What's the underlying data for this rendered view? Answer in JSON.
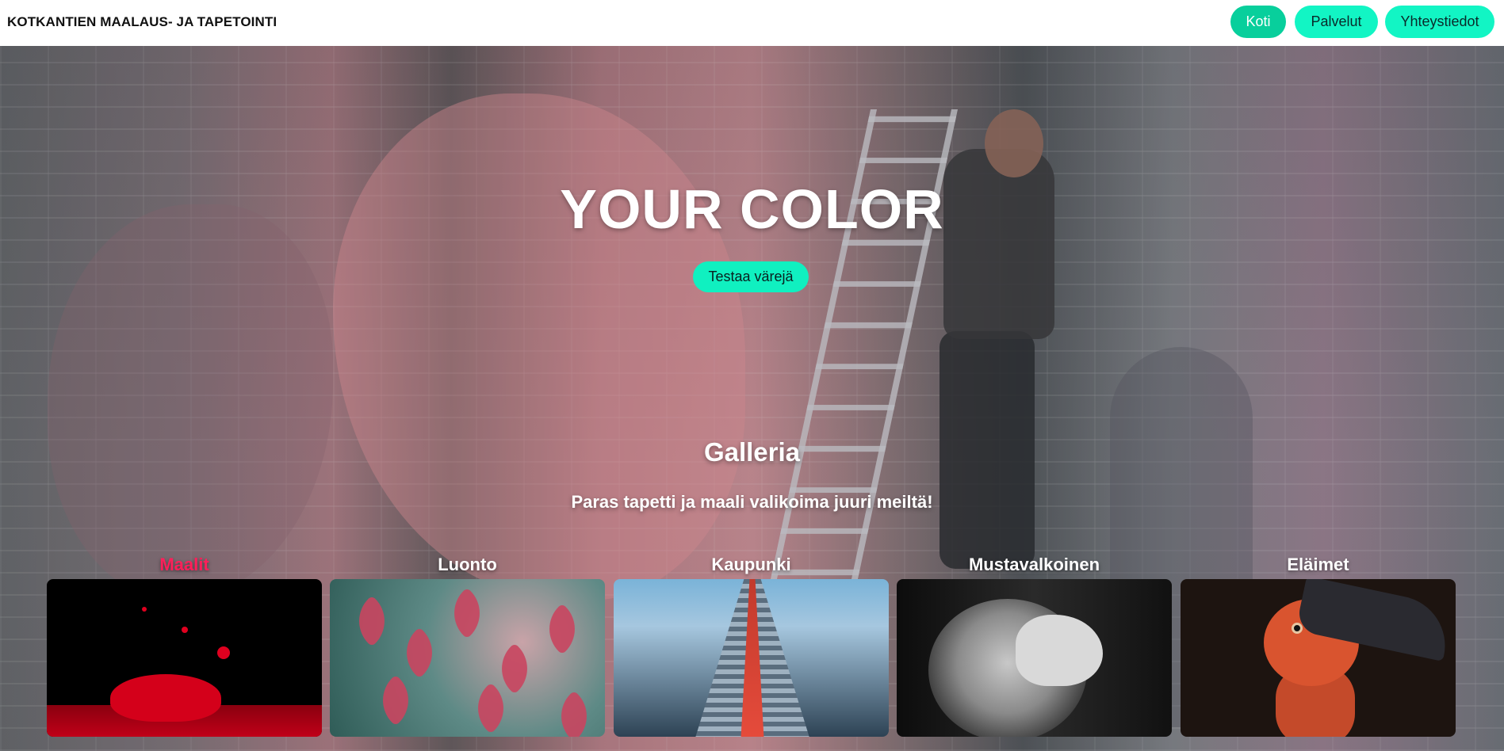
{
  "header": {
    "brand": "KOTKANTIEN MAALAUS- JA TAPETOINTI",
    "nav": [
      {
        "label": "Koti",
        "active": true
      },
      {
        "label": "Palvelut",
        "active": false
      },
      {
        "label": "Yhteystiedot",
        "active": false
      }
    ]
  },
  "hero": {
    "title": "YOUR COLOR",
    "cta_label": "Testaa värejä"
  },
  "gallery": {
    "title": "Galleria",
    "subtitle": "Paras tapetti ja maali valikoima juuri meiltä!",
    "cards": [
      {
        "label": "Maalit",
        "active": true,
        "image": "red-paint-splash"
      },
      {
        "label": "Luonto",
        "active": false,
        "image": "red-maple-leaves"
      },
      {
        "label": "Kaupunki",
        "active": false,
        "image": "high-rise-building"
      },
      {
        "label": "Mustavalkoinen",
        "active": false,
        "image": "black-white-lion"
      },
      {
        "label": "Eläimet",
        "active": false,
        "image": "hornbill-bird"
      }
    ]
  },
  "colors": {
    "accent": "#12f5c4",
    "accent_active": "#08cf9c",
    "highlight": "#ff1f5a"
  }
}
